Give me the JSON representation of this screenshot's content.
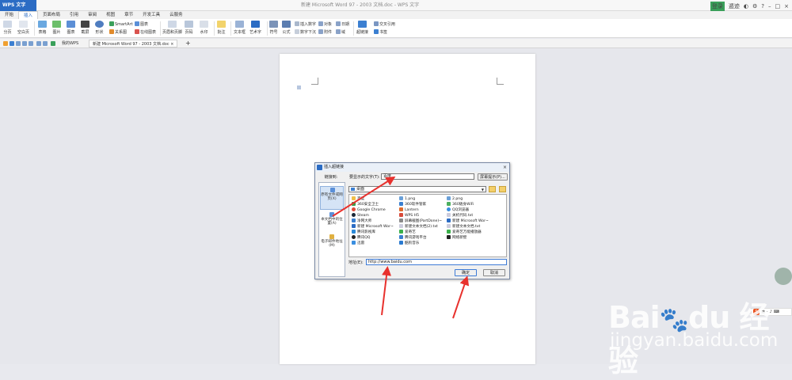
{
  "window": {
    "app_menu": "WPS 文字",
    "doc_title": "新建 Microsoft Word 97 - 2003 文档.doc - WPS 文字",
    "user_badge": "登录",
    "user_label": "遁迹"
  },
  "tabs": [
    "开始",
    "插入",
    "页面布局",
    "引用",
    "审阅",
    "视图",
    "章节",
    "开发工具",
    "云服务"
  ],
  "active_tab": "插入",
  "ribbon": {
    "page_break": "分页",
    "blank_page": "空白页",
    "table": "表格",
    "picture": "图片",
    "chart": "图表",
    "screenshot": "截屏",
    "shape": "形状",
    "smartart": "SmartArt",
    "relation_chart": "关系图",
    "icon_lib": "图表",
    "online_chart": "在线图表",
    "header_footer": "页眉和页脚",
    "page_num": "页码",
    "watermark": "水印",
    "comment": "批注",
    "textbox": "文本框",
    "wordart": "艺术字",
    "symbol": "符号",
    "formula": "公式",
    "insert_number": "插入数字",
    "number_format": "数字下沉",
    "object": "对象",
    "attachment": "附件",
    "date": "日期",
    "field": "域",
    "hyperlink": "超链接",
    "cross_ref": "交叉引用",
    "bookmark": "书签"
  },
  "quick_toolbar": {
    "tab_home": "我的WPS",
    "tab_doc": "新建 Microsoft Word 97 - 2003 文档.doc",
    "add": "+"
  },
  "dialog": {
    "title": "插入超链接",
    "link_to": "链接到:",
    "nav": [
      "原有文件或网页(X)",
      "本文档中的位置(A)",
      "电子邮件地址(M)"
    ],
    "display_label": "要显示的文字(T):",
    "display_value": "百度",
    "screen_tip": "屏幕提示(P)...",
    "look_in": "桌面",
    "files": [
      "百度",
      "1.png",
      "2.png",
      "360安全卫士",
      "360软件管家",
      "360随身WiFi",
      "Google Chrome",
      "Lantern",
      "QQ浏览器",
      "Steam",
      "WPS H5",
      "关机代码.txt",
      "净网大师",
      "屏幕截图(PartDone)~",
      "新建 Microsoft Wor~",
      "新建 Microsoft Wor~",
      "新建文本文档(2).txt",
      "新建文本文档.txt",
      "腾讯影视库",
      "爱奇艺",
      "爱奇艺万能播放器",
      "腾讯QQ",
      "腾讯游戏平台",
      "网络新壁",
      "迅雷",
      "酷狗音乐"
    ],
    "address_label": "地址(E):",
    "address_value": "http://www.baidu.com",
    "ok": "确定",
    "cancel": "取消"
  },
  "watermark": {
    "brand": "Bai",
    "brand_mid": "du",
    "brand_cn": "经验",
    "url": "jingyan.baidu.com"
  },
  "ime": {
    "logo": "S",
    "mode": "英"
  }
}
